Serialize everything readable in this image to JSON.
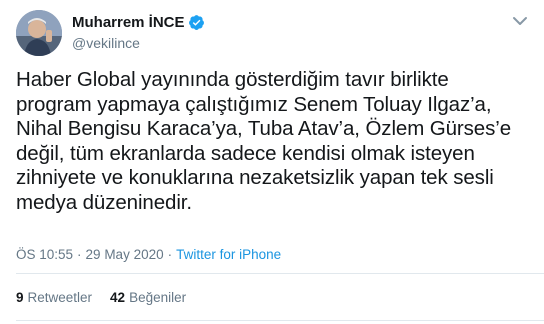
{
  "tweet": {
    "author": {
      "display_name": "Muharrem İNCE",
      "handle": "@vekilince",
      "verified": true
    },
    "text": "Haber Global yayınında gösterdiğim tavır birlikte\nprogram yapmaya çalıştığımız Senem Toluay Ilgaz’a,\nNihal Bengisu Karaca’ya, Tuba Atav’a, Özlem Gürses’e\ndeğil, tüm ekranlarda sadece kendisi olmak isteyen\nzihniyete ve konuklarına nezaketsizlik yapan tek sesli\nmedya düzeninedir.",
    "time": "ÖS 10:55",
    "separator": "·",
    "date": "29 May 2020",
    "source": "Twitter for iPhone",
    "retweets_count": "9",
    "retweets_label": "Retweetler",
    "likes_count": "42",
    "likes_label": "Beğeniler"
  },
  "colors": {
    "accent": "#1da1f2",
    "link": "#1b95e0",
    "secondary_text": "#657786",
    "divider": "#e1e8ed"
  },
  "icons": {
    "verified": "verified-badge-icon",
    "menu": "chevron-down-icon"
  }
}
